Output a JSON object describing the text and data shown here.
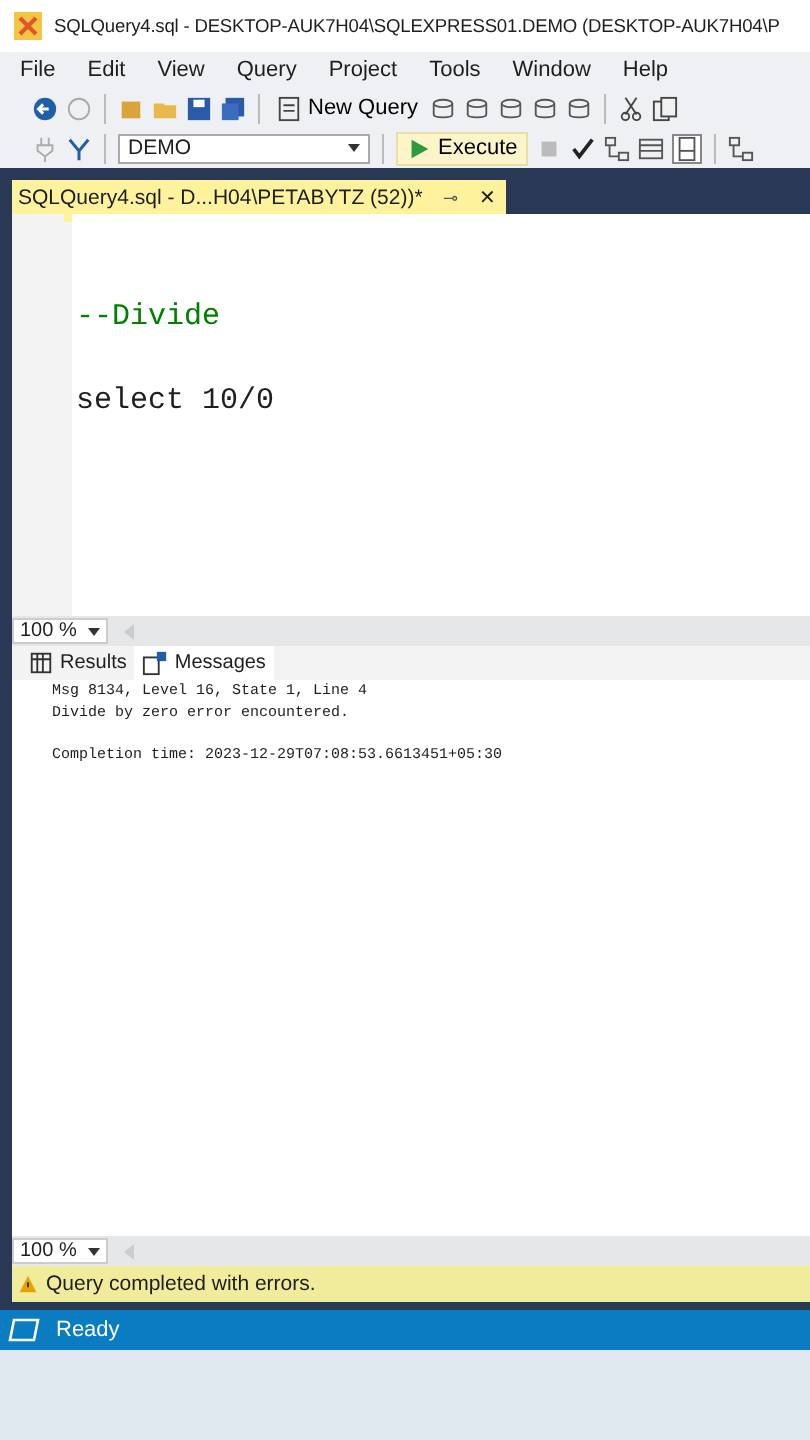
{
  "window": {
    "title": "SQLQuery4.sql - DESKTOP-AUK7H04\\SQLEXPRESS01.DEMO (DESKTOP-AUK7H04\\P"
  },
  "menu": [
    "File",
    "Edit",
    "View",
    "Query",
    "Project",
    "Tools",
    "Window",
    "Help"
  ],
  "toolbar": {
    "new_query": "New Query",
    "database": "DEMO",
    "execute": "Execute"
  },
  "document_tab": {
    "title": "SQLQuery4.sql - D...H04\\PETABYTZ (52))*",
    "pin": "⊸",
    "close": "✕"
  },
  "editor": {
    "lines": [
      {
        "kind": "blank"
      },
      {
        "kind": "comment",
        "text": "--Divide"
      },
      {
        "kind": "blank"
      },
      {
        "kind": "code",
        "text": "select 10/0"
      }
    ]
  },
  "editor_zoom": "100 %",
  "result_tabs": [
    {
      "label": "Results",
      "selected": false
    },
    {
      "label": "Messages",
      "selected": true
    }
  ],
  "messages": [
    {
      "kind": "text",
      "text": "Msg 8134, Level 16, State 1, Line 4"
    },
    {
      "kind": "text",
      "text": "Divide by zero error encountered."
    },
    {
      "kind": "blank"
    },
    {
      "kind": "text",
      "text": "Completion time: 2023-12-29T07:08:53.6613451+05:30"
    }
  ],
  "results_zoom": "100 %",
  "query_status": "Query completed with errors.",
  "status_bar": "Ready"
}
